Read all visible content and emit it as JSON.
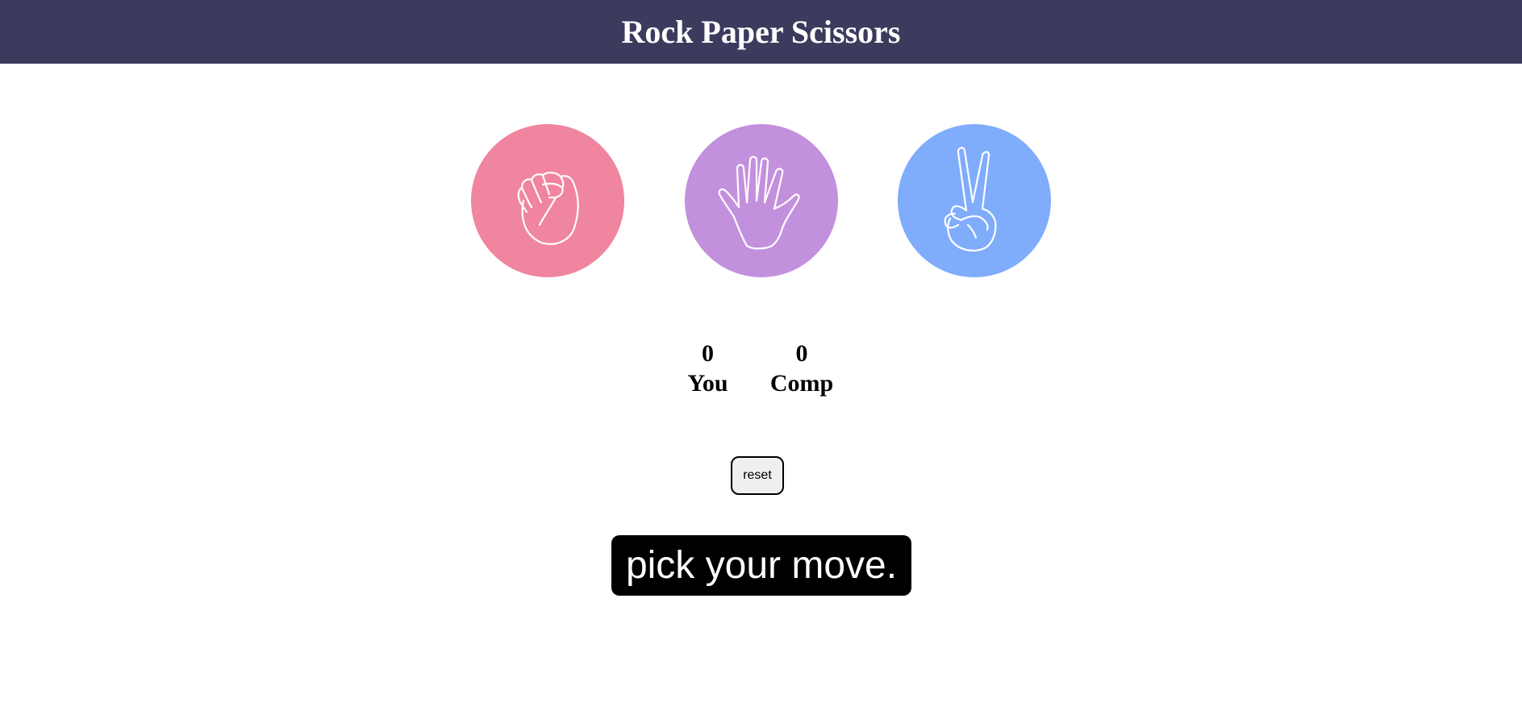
{
  "header": {
    "title": "Rock Paper Scissors"
  },
  "choices": [
    {
      "id": "rock",
      "icon": "fist-icon",
      "color": "#f085a0"
    },
    {
      "id": "paper",
      "icon": "open-hand-icon",
      "color": "#c390dd"
    },
    {
      "id": "scissors",
      "icon": "peace-hand-icon",
      "color": "#80acfc"
    }
  ],
  "score": {
    "you": {
      "value": "0",
      "label": "You"
    },
    "comp": {
      "value": "0",
      "label": "Comp"
    }
  },
  "controls": {
    "reset_label": "reset"
  },
  "status": {
    "message": "pick your move."
  },
  "colors": {
    "header_bg": "#3c3b5e",
    "message_bg": "#000000"
  }
}
